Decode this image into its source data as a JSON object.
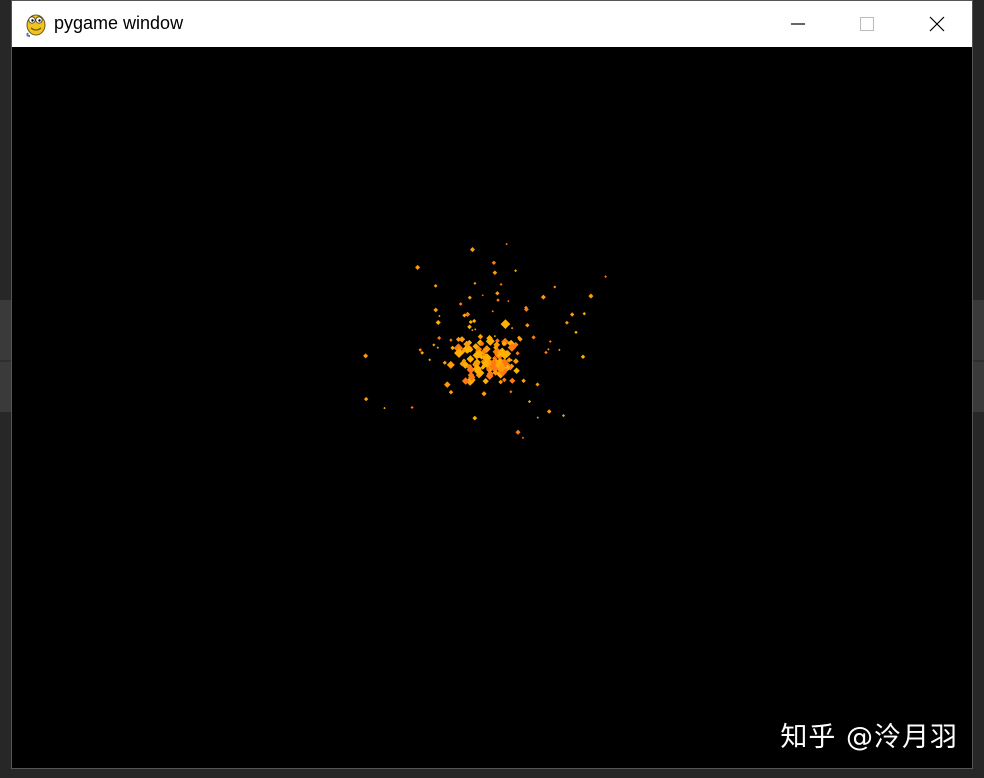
{
  "window": {
    "title": "pygame window",
    "app_icon": "pygame-snake-icon"
  },
  "controls": {
    "minimize_icon": "minimize-icon",
    "maximize_icon": "maximize-icon",
    "close_icon": "close-icon"
  },
  "scene": {
    "description_icon": "particle-burst",
    "colors": {
      "particle_light": "#ffb000",
      "particle_mid": "#ff9a0a",
      "particle_dark": "#ff7a12",
      "background": "#000000"
    }
  },
  "watermark": {
    "text": "知乎 @泠月羽"
  }
}
